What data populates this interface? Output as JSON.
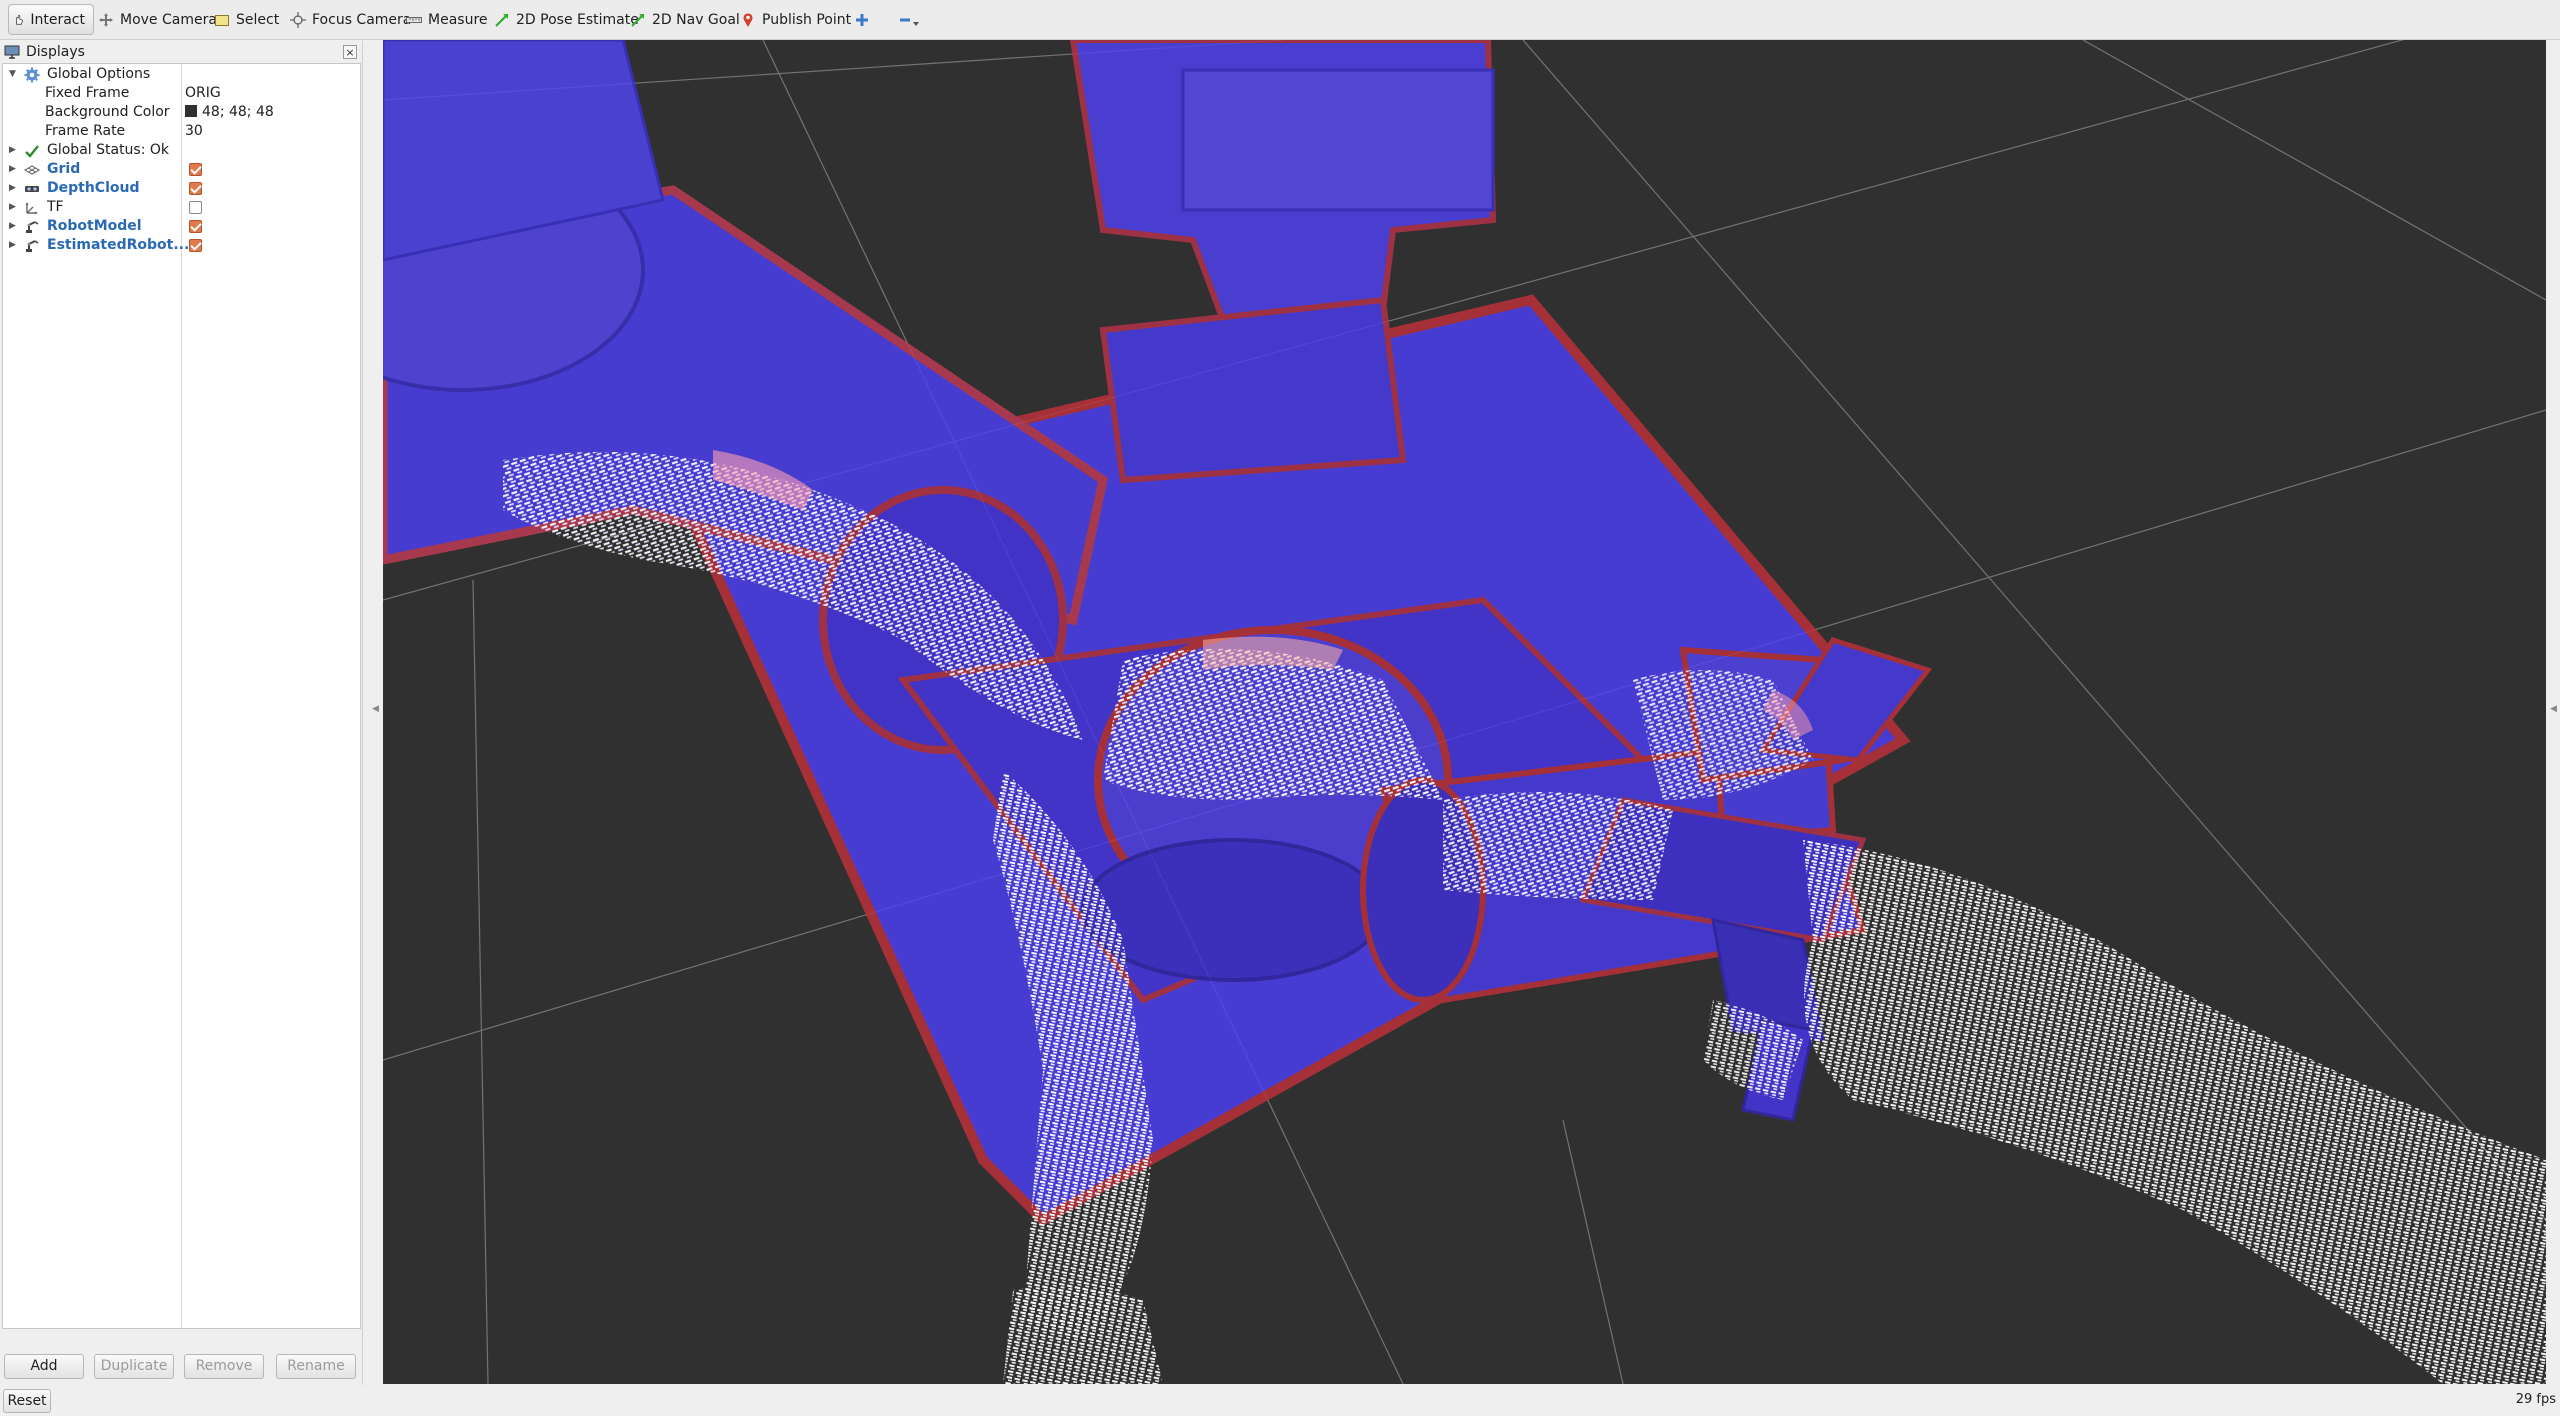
{
  "toolbar": {
    "interact": "Interact",
    "move_camera": "Move Camera",
    "select": "Select",
    "focus_camera": "Focus Camera",
    "measure": "Measure",
    "pose_estimate": "2D Pose Estimate",
    "nav_goal": "2D Nav Goal",
    "publish_point": "Publish Point"
  },
  "displays_panel": {
    "title": "Displays",
    "global_options": {
      "label": "Global Options",
      "fixed_frame_label": "Fixed Frame",
      "fixed_frame_value": "ORIG",
      "background_color_label": "Background Color",
      "background_color_value": "48; 48; 48",
      "frame_rate_label": "Frame Rate",
      "frame_rate_value": "30"
    },
    "global_status": "Global Status: Ok",
    "displays": [
      {
        "name": "Grid",
        "enabled": true,
        "icon": "grid-icon"
      },
      {
        "name": "DepthCloud",
        "enabled": true,
        "icon": "depth-camera-icon"
      },
      {
        "name": "TF",
        "enabled": false,
        "icon": "tf-icon"
      },
      {
        "name": "RobotModel",
        "enabled": true,
        "icon": "robot-model-icon"
      },
      {
        "name": "EstimatedRobot...",
        "enabled": true,
        "icon": "robot-model-icon"
      }
    ],
    "buttons": {
      "add": "Add",
      "duplicate": "Duplicate",
      "remove": "Remove",
      "rename": "Rename"
    }
  },
  "status_bar": {
    "reset": "Reset",
    "fps": "29 fps"
  },
  "colors": {
    "view_background": "#303030",
    "robot_blue": "#4a3cf0",
    "robot_red": "#b8324a",
    "point_cloud": "#ffffff",
    "checkbox_on": "#e07a4c",
    "display_name": "#2a6ab5"
  }
}
